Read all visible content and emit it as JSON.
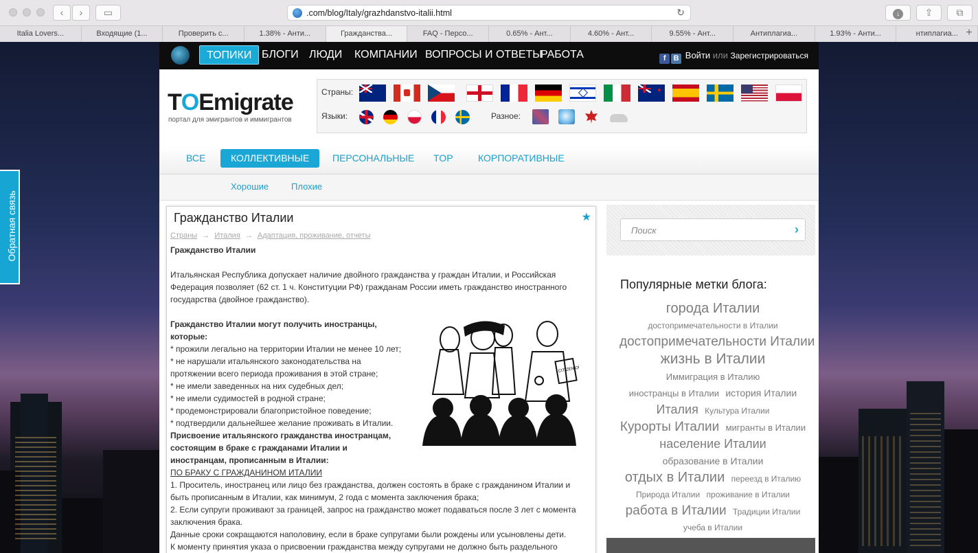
{
  "browser": {
    "url": ".com/blog/Italy/grazhdanstvo-italii.html",
    "tabs": [
      "Italia Lovers...",
      "Входящие (1...",
      "Проверить с...",
      "1.38% - Анти...",
      "Гражданства...",
      "FAQ - Персо...",
      "0.65% - Ант...",
      "4.60% - Ант...",
      "9.55% - Ант...",
      "Антиплагиа...",
      "1.93% - Анти...",
      "нтиплагиа..."
    ],
    "active_tab": 4
  },
  "topnav": {
    "items": [
      "ТОПИКИ",
      "БЛОГИ",
      "ЛЮДИ",
      "КОМПАНИИ",
      "ВОПРОСЫ И ОТВЕТЫ",
      "РАБОТА"
    ],
    "login": "Войти",
    "or": "или",
    "register": "Зарегистрироваться"
  },
  "logo": {
    "brand_prefix": "T",
    "brand_mark": "O",
    "brand_rest": "Emigrate",
    "tagline": "портал для эмигрантов и иммигрантов"
  },
  "filters": {
    "countries_label": "Страны:",
    "languages_label": "Языки:",
    "misc_label": "Разное:"
  },
  "category_tabs": [
    "ВСЕ",
    "КОЛЛЕКТИВНЫЕ",
    "ПЕРСОНАЛЬНЫЕ",
    "TOP",
    "КОРПОРАТИВНЫЕ"
  ],
  "sub_tabs": [
    "Хорошие",
    "Плохие"
  ],
  "article": {
    "title": "Гражданство Италии",
    "breadcrumb": [
      "Страны",
      "Италия",
      "Адаптация, проживание, отчеты"
    ],
    "heading": "Гражданство Италии",
    "intro": "Итальянская Республика допускает наличие двойного гражданства у граждан Италии, и Российская Федерация позволяет (62 ст. 1 ч. Конституции РФ) гражданам России иметь гражданство иностранного государства (двойное гражданство).",
    "who_heading_1": "Гражданство Италии могут получить иностранцы,",
    "who_heading_2": "которые:",
    "conditions": [
      "* прожили легально на территории Италии не менее 10 лет;",
      "* не нарушали итальянского законодательства на",
      "протяжении всего периода проживания в этой стране;",
      "* не имели заведенных на них судебных дел;",
      "* не имели судимостей в родной стране;",
      "* продемонстрировали благопристойное поведение;",
      "* подтвердили дальнейшее желание проживать в Италии."
    ],
    "marriage_heading": [
      "Присвоение итальянского гражданства иностранцам,",
      "состоящим в браке с гражданами Италии и",
      "иностранцам, прописанным в Италии:"
    ],
    "marriage_sub": "ПО БРАКУ С ГРАЖДАНИНОМ ИТАЛИИ",
    "rules": [
      "1. Проситель, иностранец или лицо без гражданства, должен состоять в браке с гражданином Италии и",
      "быть прописанным в Италии, как минимум, 2 года с момента заключения брака;",
      "2. Если супруги проживают за границей, запрос на гражданство может подаваться после 3 лет с момента",
      "заключения брака.",
      "Данные сроки сокращаются наполовину, если в браке супругами были рождены или усыновлены дети.",
      "К моменту принятия указа о присвоении гражданства между супругами не должно быть раздельного"
    ],
    "cartoon_sign": "CITIZEN OF AUSTRALIA"
  },
  "sidebar": {
    "search_placeholder": "Поиск",
    "tags_title": "Популярные метки блога:",
    "tags": [
      {
        "text": "города Италии",
        "size": 20
      },
      {
        "text": "достопримечательности в Италии",
        "size": 12
      },
      {
        "text": "достопримечательности Италии",
        "size": 19
      },
      {
        "text": "жизнь в Италии",
        "size": 21
      },
      {
        "text": "Иммиграция в Италию",
        "size": 13
      },
      {
        "text": "иностранцы в Италии",
        "size": 13
      },
      {
        "text": "история Италии",
        "size": 14
      },
      {
        "text": "Италия",
        "size": 18
      },
      {
        "text": "Культура Италии",
        "size": 12
      },
      {
        "text": "Курорты Италии",
        "size": 19
      },
      {
        "text": "мигранты в Италии",
        "size": 13
      },
      {
        "text": "население Италии",
        "size": 18
      },
      {
        "text": "образование в Италии",
        "size": 14
      },
      {
        "text": "отдых в Италии",
        "size": 20
      },
      {
        "text": "переезд в Италию",
        "size": 12
      },
      {
        "text": "Природа Италии",
        "size": 12
      },
      {
        "text": "проживание в Италии",
        "size": 12
      },
      {
        "text": "работа в Италии",
        "size": 19
      },
      {
        "text": "Традиции Италии",
        "size": 12
      },
      {
        "text": "учеба в Италии",
        "size": 12
      }
    ]
  },
  "feedback": "Обратная связь",
  "colors": {
    "accent": "#1ba7d6",
    "nav_bg": "#0d0d0d",
    "tag_gray": "#7d7d7d"
  }
}
